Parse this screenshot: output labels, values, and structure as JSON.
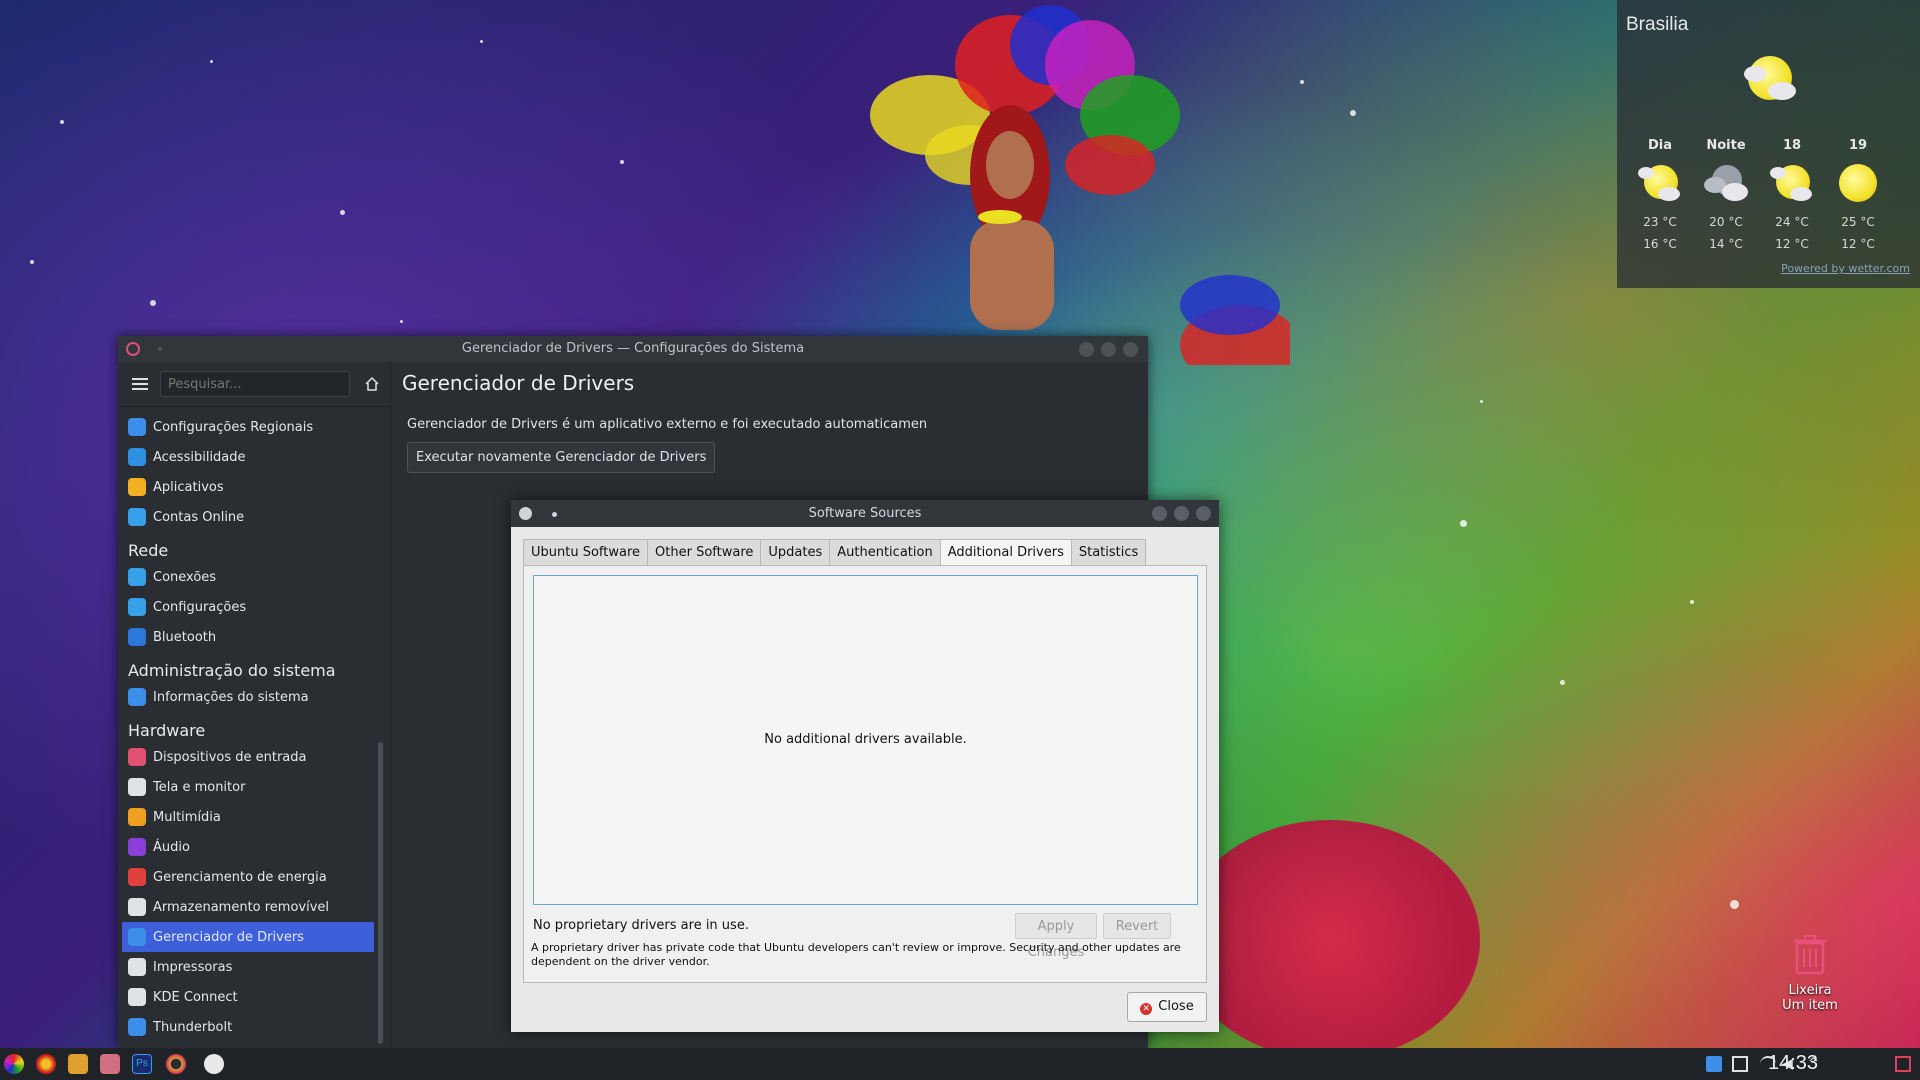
{
  "weather": {
    "city": "Brasilia",
    "columns": [
      {
        "label": "Dia",
        "icon": "partly-cloudy-day-icon",
        "high": "23 °C",
        "low": "16 °C"
      },
      {
        "label": "Noite",
        "icon": "cloudy-night-icon",
        "high": "20 °C",
        "low": "14 °C"
      },
      {
        "label": "18",
        "icon": "partly-cloudy-day-icon",
        "high": "24 °C",
        "low": "12 °C"
      },
      {
        "label": "19",
        "icon": "sun-icon",
        "high": "25 °C",
        "low": "12 °C"
      }
    ],
    "powered": "Powered by wetter.com"
  },
  "settings": {
    "title": "Gerenciador de Drivers — Configurações do Sistema",
    "search_placeholder": "Pesquisar...",
    "sidebar": {
      "items": [
        {
          "type": "item",
          "label": "Configurações Regionais",
          "icon_color": "#3d8ee8"
        },
        {
          "type": "item",
          "label": "Acessibilidade",
          "icon_color": "#2f8fe0"
        },
        {
          "type": "item",
          "label": "Aplicativos",
          "icon_color": "#f0b020"
        },
        {
          "type": "item",
          "label": "Contas Online",
          "icon_color": "#38a0e8"
        },
        {
          "type": "head",
          "label": "Rede"
        },
        {
          "type": "item",
          "label": "Conexões",
          "icon_color": "#38a0e8"
        },
        {
          "type": "item",
          "label": "Configurações",
          "icon_color": "#38a0e8"
        },
        {
          "type": "item",
          "label": "Bluetooth",
          "icon_color": "#2a78d8"
        },
        {
          "type": "head",
          "label": "Administração do sistema"
        },
        {
          "type": "item",
          "label": "Informações do sistema",
          "icon_color": "#3d8ee8"
        },
        {
          "type": "head",
          "label": "Hardware"
        },
        {
          "type": "item",
          "label": "Dispositivos de entrada",
          "icon_color": "#e05070"
        },
        {
          "type": "item",
          "label": "Tela e monitor",
          "icon_color": "#dfe3e7"
        },
        {
          "type": "item",
          "label": "Multimídia",
          "icon_color": "#f0a020"
        },
        {
          "type": "item",
          "label": "Áudio",
          "icon_color": "#8a40d8"
        },
        {
          "type": "item",
          "label": "Gerenciamento de energia",
          "icon_color": "#e04040"
        },
        {
          "type": "item",
          "label": "Armazenamento removível",
          "icon_color": "#dfe3e7"
        },
        {
          "type": "item",
          "label": "Gerenciador de Drivers",
          "icon_color": "#3d8ee8",
          "active": true
        },
        {
          "type": "item",
          "label": "Impressoras",
          "icon_color": "#dfe3e7"
        },
        {
          "type": "item",
          "label": "KDE Connect",
          "icon_color": "#dfe3e7"
        },
        {
          "type": "item",
          "label": "Thunderbolt",
          "icon_color": "#3d8ee8"
        }
      ]
    },
    "main": {
      "heading": "Gerenciador de Drivers",
      "description": "Gerenciador de Drivers é um aplicativo externo e foi executado automaticamen",
      "rerun_button": "Executar novamente Gerenciador de Drivers"
    }
  },
  "sources": {
    "title": "Software Sources",
    "tabs": [
      "Ubuntu Software",
      "Other Software",
      "Updates",
      "Authentication",
      "Additional Drivers",
      "Statistics"
    ],
    "active_tab": "Additional Drivers",
    "empty_message": "No additional drivers available.",
    "status": "No proprietary drivers are in use.",
    "apply_label": "Apply Changes",
    "revert_label": "Revert",
    "note": "A proprietary driver has private code that Ubuntu developers can't review or improve. Security and other updates are dependent on the driver vendor.",
    "close_label": "Close"
  },
  "desktop": {
    "trash_label": "Lixeira",
    "trash_sub": "Um item"
  },
  "taskbar": {
    "clock": "14:33"
  }
}
